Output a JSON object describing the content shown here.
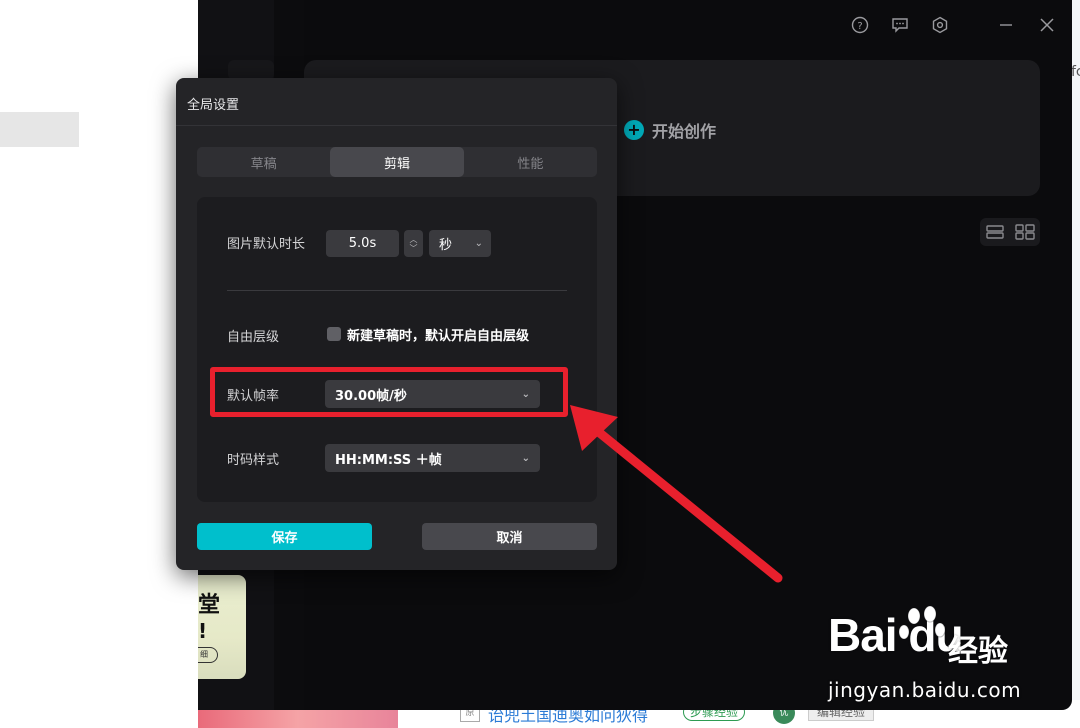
{
  "background_page": {
    "right_strip_text": "fc",
    "promo_card": {
      "line1": "堂",
      "line2": "!",
      "button": "细"
    },
    "bottom_article": {
      "link_text": "诒兜土国迪奥如问狄得",
      "badge": "步骤经验",
      "button": "编辑经验",
      "icon_label": "原",
      "avatar_label": "优"
    }
  },
  "app_window": {
    "toolbar": {
      "help_icon": "question-circle-icon",
      "feedback_icon": "feedback-icon",
      "settings_icon": "gear-icon",
      "minimize_icon": "minimize-icon",
      "close_icon": "close-icon"
    },
    "start_create": {
      "label": "开始创作",
      "icon": "plus-circle-icon"
    },
    "view_toggle": {
      "list_icon": "list-view-icon",
      "grid_icon": "grid-view-icon"
    }
  },
  "dialog": {
    "title": "全局设置",
    "tabs": [
      {
        "label": "草稿",
        "active": false
      },
      {
        "label": "剪辑",
        "active": true
      },
      {
        "label": "性能",
        "active": false
      }
    ],
    "rows": {
      "image_duration": {
        "label": "图片默认时长",
        "value": "5.0s",
        "unit": "秒"
      },
      "free_layer": {
        "label": "自由层级",
        "checkbox_text": "新建草稿时，默认开启自由层级",
        "checked": false
      },
      "frame_rate": {
        "label": "默认帧率",
        "value": "30.00帧/秒"
      },
      "timecode": {
        "label": "时码样式",
        "value": "HH:MM:SS ＋帧"
      }
    },
    "buttons": {
      "save": "保存",
      "cancel": "取消"
    }
  },
  "annotation": {
    "highlight_color": "#e8202d",
    "arrow_color": "#e8202d"
  },
  "watermark": {
    "logo": "Bai du",
    "title": "经验",
    "url": "jingyan.baidu.com"
  },
  "colors": {
    "accent": "#00bfcc",
    "dialog_bg": "#242427",
    "panel_bg": "#1c1c1f",
    "app_bg": "#0b0b0d"
  }
}
